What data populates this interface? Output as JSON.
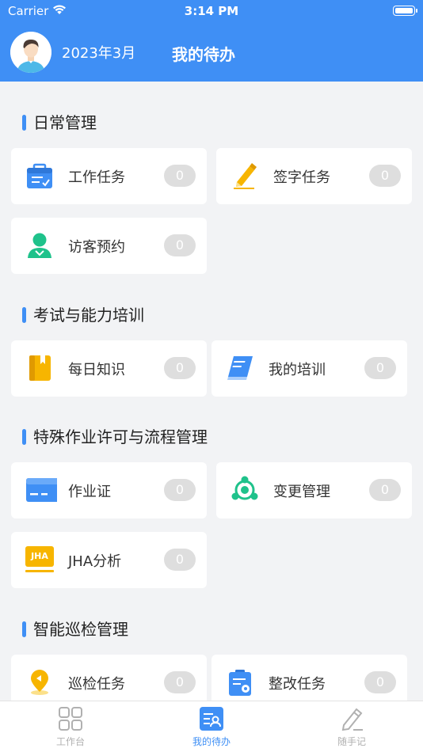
{
  "status_bar": {
    "carrier": "Carrier",
    "time": "3:14 PM"
  },
  "header": {
    "date": "2023年3月",
    "title": "我的待办"
  },
  "sections": [
    {
      "title": "日常管理",
      "cards": [
        {
          "label": "工作任务",
          "count": "0",
          "icon": "briefcase-icon"
        },
        {
          "label": "签字任务",
          "count": "0",
          "icon": "pen-icon"
        },
        {
          "label": "访客预约",
          "count": "0",
          "icon": "visitor-icon"
        }
      ]
    },
    {
      "title": "考试与能力培训",
      "cards": [
        {
          "label": "每日知识",
          "count": "0",
          "icon": "notebook-icon"
        },
        {
          "label": "我的培训",
          "count": "0",
          "icon": "book-icon"
        }
      ]
    },
    {
      "title": "特殊作业许可与流程管理",
      "cards": [
        {
          "label": "作业证",
          "count": "0",
          "icon": "card-icon"
        },
        {
          "label": "变更管理",
          "count": "0",
          "icon": "change-icon"
        },
        {
          "label": "JHA分析",
          "count": "0",
          "icon": "jha-icon",
          "icon_text": "JHA"
        }
      ]
    },
    {
      "title": "智能巡检管理",
      "cards": [
        {
          "label": "巡检任务",
          "count": "0",
          "icon": "location-icon"
        },
        {
          "label": "整改任务",
          "count": "0",
          "icon": "rectify-icon"
        }
      ]
    }
  ],
  "tabbar": [
    {
      "label": "工作台",
      "icon": "grid-icon",
      "active": false
    },
    {
      "label": "我的待办",
      "icon": "todo-icon",
      "active": true
    },
    {
      "label": "随手记",
      "icon": "note-pen-icon",
      "active": false
    }
  ],
  "colors": {
    "accent": "#3f8ff5",
    "badge": "#dedede",
    "background": "#f2f3f5"
  }
}
